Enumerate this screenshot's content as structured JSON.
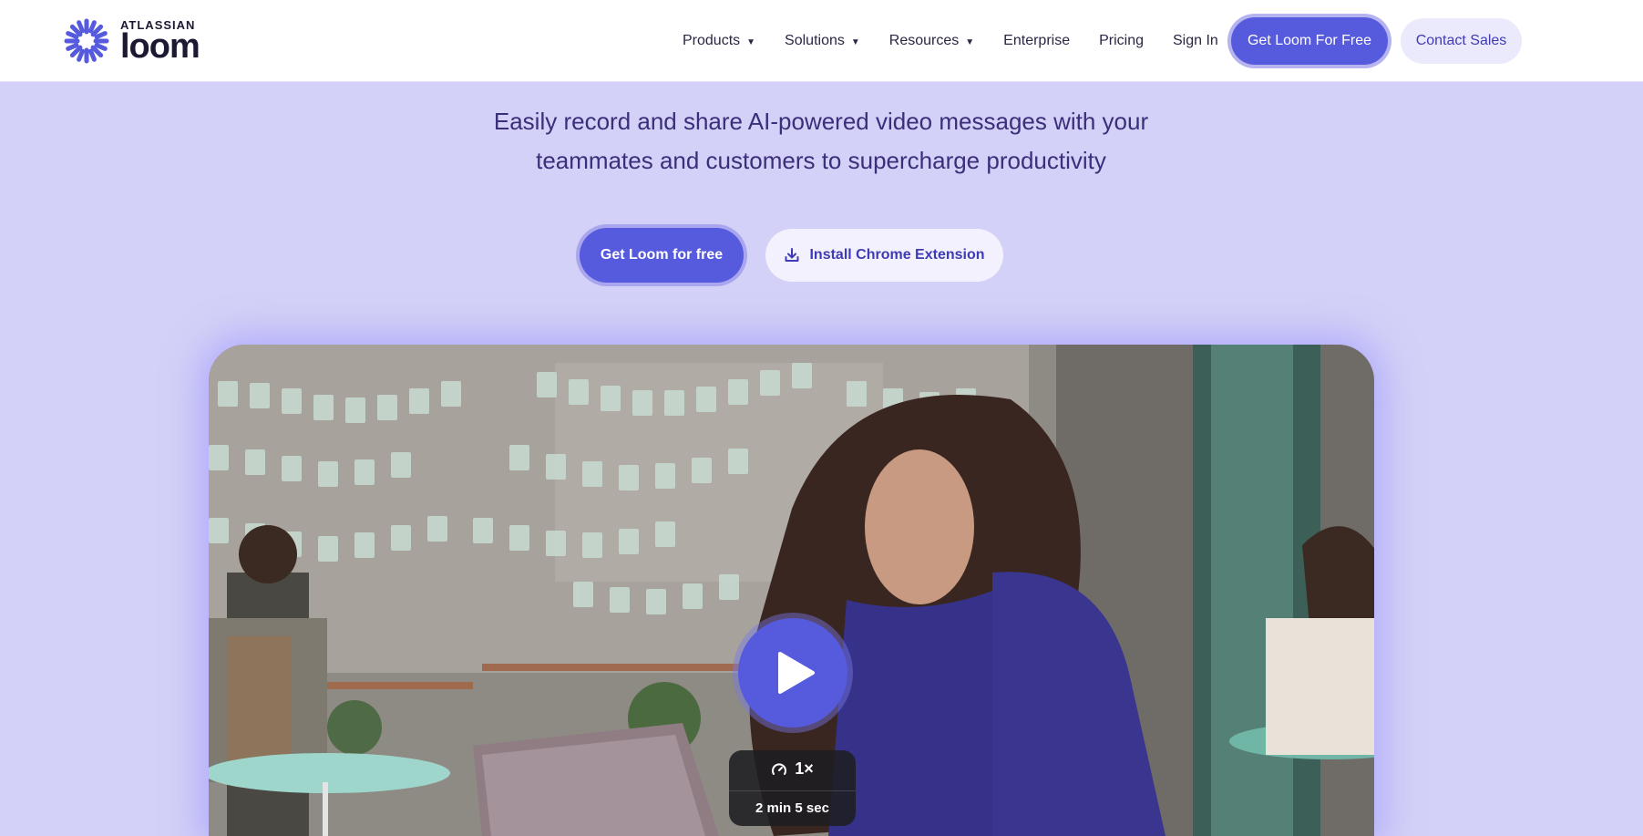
{
  "header": {
    "logo": {
      "top_text": "ATLASSIAN",
      "main_text": "loom"
    },
    "nav": [
      {
        "label": "Products",
        "has_dropdown": true
      },
      {
        "label": "Solutions",
        "has_dropdown": true
      },
      {
        "label": "Resources",
        "has_dropdown": true
      },
      {
        "label": "Enterprise",
        "has_dropdown": false
      },
      {
        "label": "Pricing",
        "has_dropdown": false
      },
      {
        "label": "Sign In",
        "has_dropdown": false
      }
    ],
    "primary_button": "Get Loom For Free",
    "secondary_button": "Contact Sales"
  },
  "hero": {
    "subtitle_line1": "Easily record and share AI-powered video messages with your",
    "subtitle_line2": "teammates and customers to supercharge productivity",
    "cta_primary": "Get Loom for free",
    "cta_secondary": "Install Chrome Extension",
    "cta_secondary_icon": "download-icon"
  },
  "video": {
    "play_icon": "play-icon",
    "speed_icon": "speedometer-icon",
    "speed": "1×",
    "duration": "2 min 5 sec"
  },
  "colors": {
    "accent": "#565add",
    "background": "#d3d1f7",
    "header_bg": "#ffffff",
    "text_dark": "#3a2f7a"
  }
}
